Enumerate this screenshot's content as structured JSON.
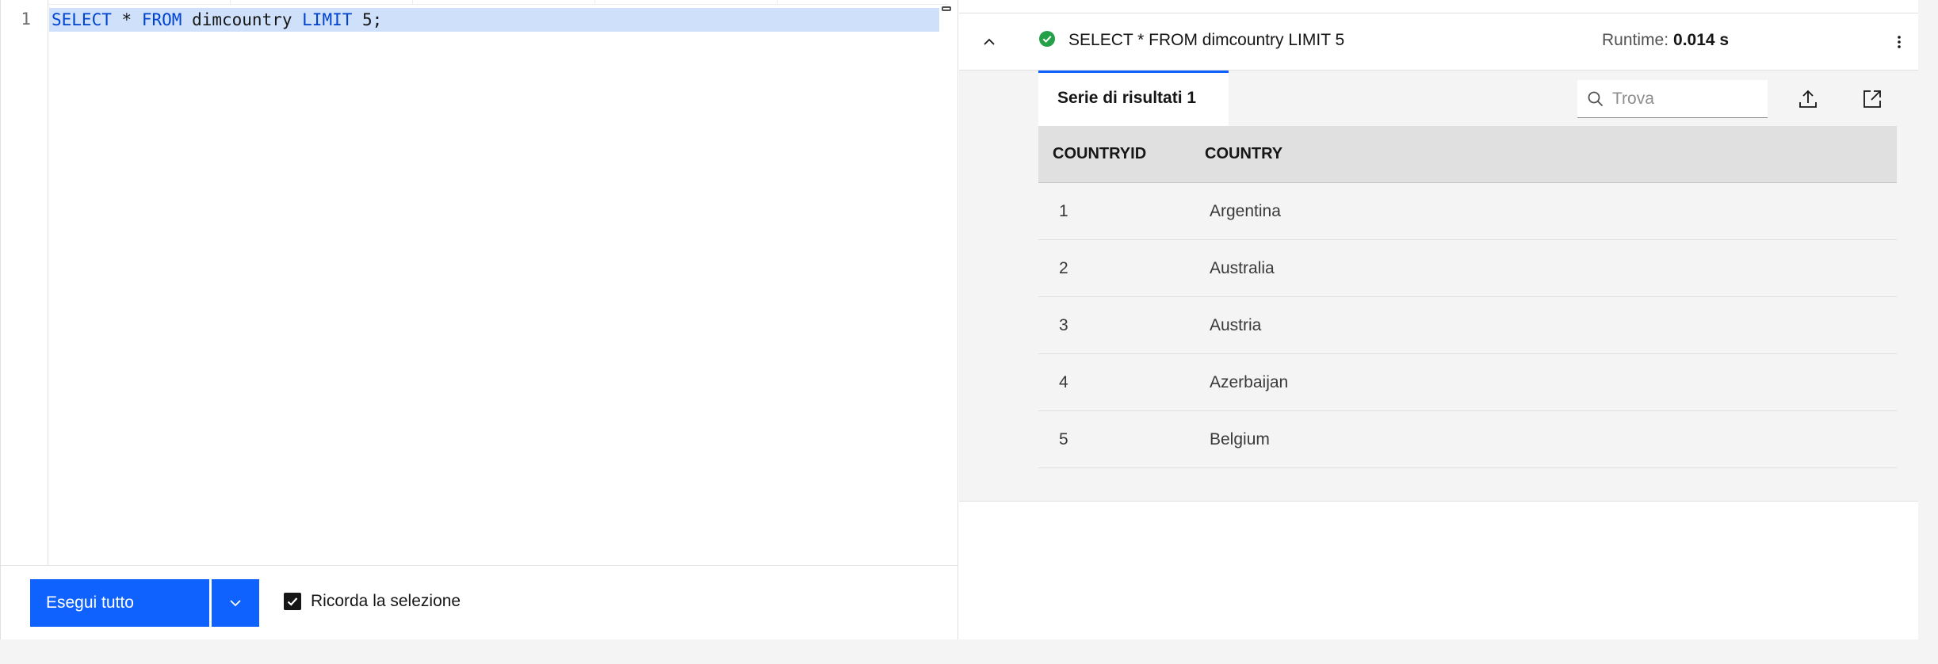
{
  "editor": {
    "line_number": "1",
    "code": {
      "kw_select": "SELECT",
      "star": "*",
      "kw_from": "FROM",
      "table": "dimcountry",
      "kw_limit": "LIMIT",
      "limit_value": "5;"
    },
    "run_button_label": "Esegui tutto",
    "remember_selection_label": "Ricorda la selezione",
    "remember_selection_checked": true
  },
  "result": {
    "status": "success",
    "query_title": "SELECT * FROM dimcountry LIMIT 5",
    "runtime_label": "Runtime:",
    "runtime_value": "0.014 s",
    "tab_label": "Serie di risultati 1",
    "search_placeholder": "Trova",
    "columns": [
      "COUNTRYID",
      "COUNTRY"
    ],
    "rows": [
      [
        "1",
        "Argentina"
      ],
      [
        "2",
        "Australia"
      ],
      [
        "3",
        "Austria"
      ],
      [
        "4",
        "Azerbaijan"
      ],
      [
        "5",
        "Belgium"
      ]
    ]
  },
  "colors": {
    "primary": "#0f62fe",
    "success": "#24a148",
    "selection": "#cfe0fb",
    "keyword": "#0043ce"
  },
  "icons": {
    "status": "checkmark-filled-icon",
    "collapse": "chevron-up-icon",
    "overflow": "overflow-menu-vertical-icon",
    "search": "search-icon",
    "export": "upload-icon",
    "open": "launch-icon",
    "dropdown": "chevron-down-icon",
    "checkbox": "checkmark-icon"
  }
}
